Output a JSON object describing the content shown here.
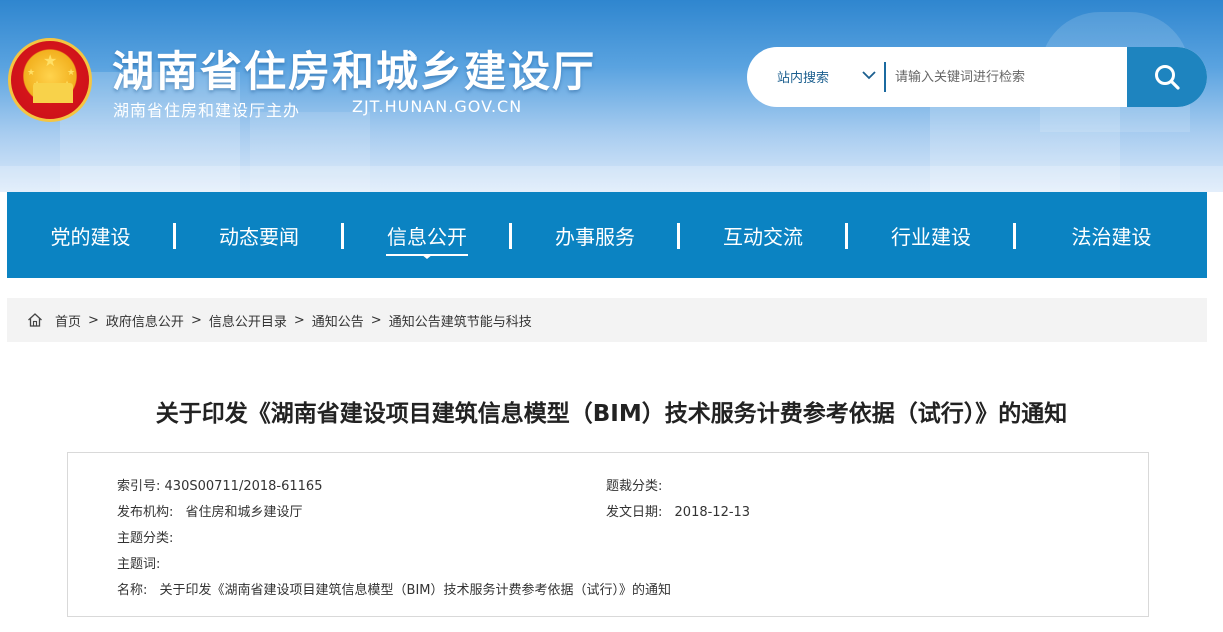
{
  "header": {
    "site_title": "湖南省住房和城乡建设厅",
    "subtitle": "湖南省住房和建设厅主办",
    "domain": "ZJT.HUNAN.GOV.CN"
  },
  "search": {
    "scope": "站内搜索",
    "placeholder": "请输入关键词进行检索",
    "button_icon": "search-icon"
  },
  "nav": {
    "items": [
      {
        "label": "党的建设"
      },
      {
        "label": "动态要闻"
      },
      {
        "label": "信息公开",
        "active": true
      },
      {
        "label": "办事服务"
      },
      {
        "label": "互动交流"
      },
      {
        "label": "行业建设"
      },
      {
        "label": "法治建设"
      }
    ]
  },
  "breadcrumb": {
    "items": [
      "首页",
      "政府信息公开",
      "信息公开目录",
      "通知公告",
      "通知公告建筑节能与科技"
    ],
    "separator": ">"
  },
  "article": {
    "title": "关于印发《湖南省建设项目建筑信息模型（BIM）技术服务计费参考依据（试行）》的通知",
    "meta": {
      "index_label": "索引号:",
      "index_value": "430S00711/2018-61165",
      "genre_label": "题裁分类:",
      "genre_value": "",
      "issuer_label": "发布机构:",
      "issuer_value": "省住房和城乡建设厅",
      "date_label": "发文日期:",
      "date_value": "2018-12-13",
      "topic_label": "主题分类:",
      "topic_value": "",
      "keywords_label": "主题词:",
      "keywords_value": "",
      "name_label": "名称:",
      "name_value": "关于印发《湖南省建设项目建筑信息模型（BIM）技术服务计费参考依据（试行）》的通知"
    }
  },
  "colors": {
    "nav_bg": "#0b83c2",
    "search_button": "#1e84bf",
    "breadcrumb_bg": "#f3f3f3"
  }
}
